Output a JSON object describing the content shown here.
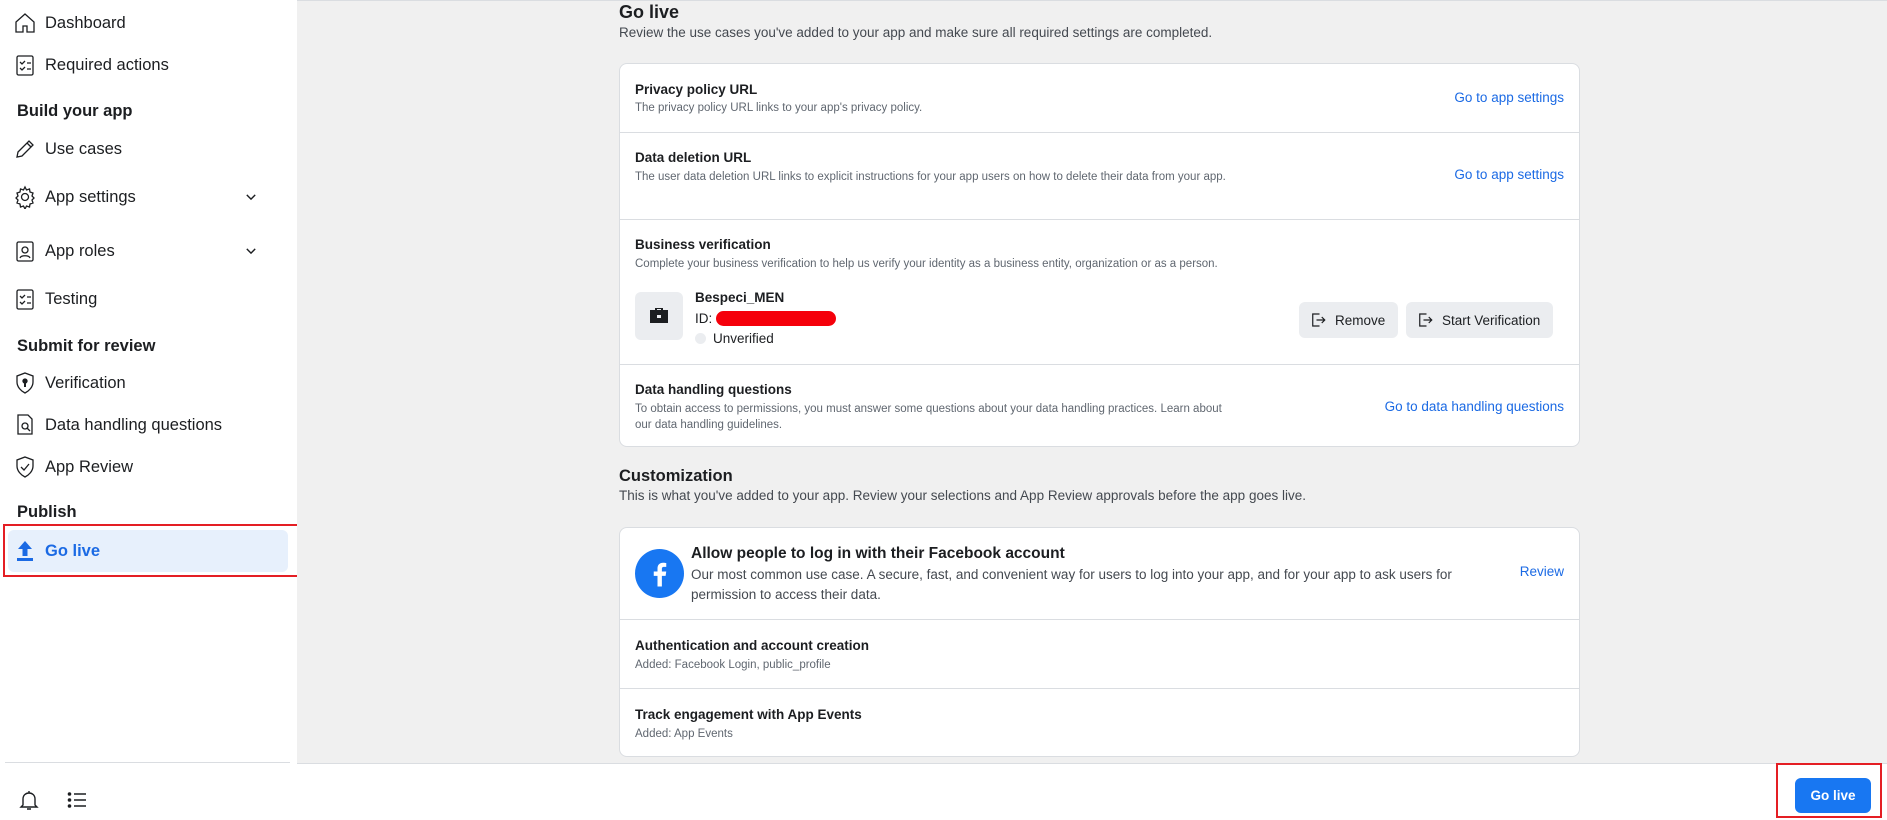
{
  "sidebar": {
    "items": [
      {
        "label": "Dashboard",
        "icon": "home-icon"
      },
      {
        "label": "Required actions",
        "icon": "checklist-icon"
      },
      {
        "label": "Use cases",
        "icon": "pencil-icon"
      },
      {
        "label": "App settings",
        "icon": "gear-icon"
      },
      {
        "label": "App roles",
        "icon": "id-badge-icon"
      },
      {
        "label": "Testing",
        "icon": "checklist-icon"
      },
      {
        "label": "Verification",
        "icon": "shield-icon"
      },
      {
        "label": "Data handling questions",
        "icon": "doc-search-icon"
      },
      {
        "label": "App Review",
        "icon": "badge-check-icon"
      },
      {
        "label": "Go live",
        "icon": "upload-icon"
      }
    ],
    "sections": {
      "build": "Build your app",
      "submit": "Submit for review",
      "publish": "Publish"
    },
    "bottom_icons": [
      "bell-icon",
      "list-icon"
    ]
  },
  "main": {
    "title": "Go live",
    "subtitle": "Review the use cases you've added to your app and make sure all required settings are completed.",
    "requirements": {
      "privacy": {
        "title": "Privacy policy URL",
        "desc": "The privacy policy URL links to your app's privacy policy.",
        "link": "Go to app settings"
      },
      "deletion": {
        "title": "Data deletion URL",
        "desc": "The user data deletion URL links to explicit instructions for your app users on how to delete their data from your app.",
        "link": "Go to app settings"
      },
      "business": {
        "title": "Business verification",
        "desc": "Complete your business verification to help us verify your identity as a business entity, organization or as a person.",
        "name": "Bespeci_MEN",
        "id_label": "ID:",
        "status": "Unverified",
        "remove": "Remove",
        "start": "Start Verification"
      },
      "data_handling": {
        "title": "Data handling questions",
        "desc": "To obtain access to permissions, you must answer some questions about your data handling practices. Learn about our data handling guidelines.",
        "link": "Go to data handling questions"
      }
    },
    "customization": {
      "title": "Customization",
      "subtitle": "This is what you've added to your app. Review your selections and App Review approvals before the app goes live.",
      "use_case": {
        "title": "Allow people to log in with their Facebook account",
        "desc": "Our most common use case. A secure, fast, and convenient way for users to log into your app, and for your app to ask users for permission to access their data.",
        "link": "Review"
      },
      "auth": {
        "title": "Authentication and account creation",
        "added": "Added: Facebook Login, public_profile"
      },
      "track": {
        "title": "Track engagement with App Events",
        "added": "Added: App Events"
      }
    }
  },
  "footer": {
    "go_live_button": "Go live"
  },
  "colors": {
    "accent": "#1877f2",
    "link": "#1b6ae4",
    "highlight": "#e41e24",
    "active_bg": "#e7f0fc"
  }
}
